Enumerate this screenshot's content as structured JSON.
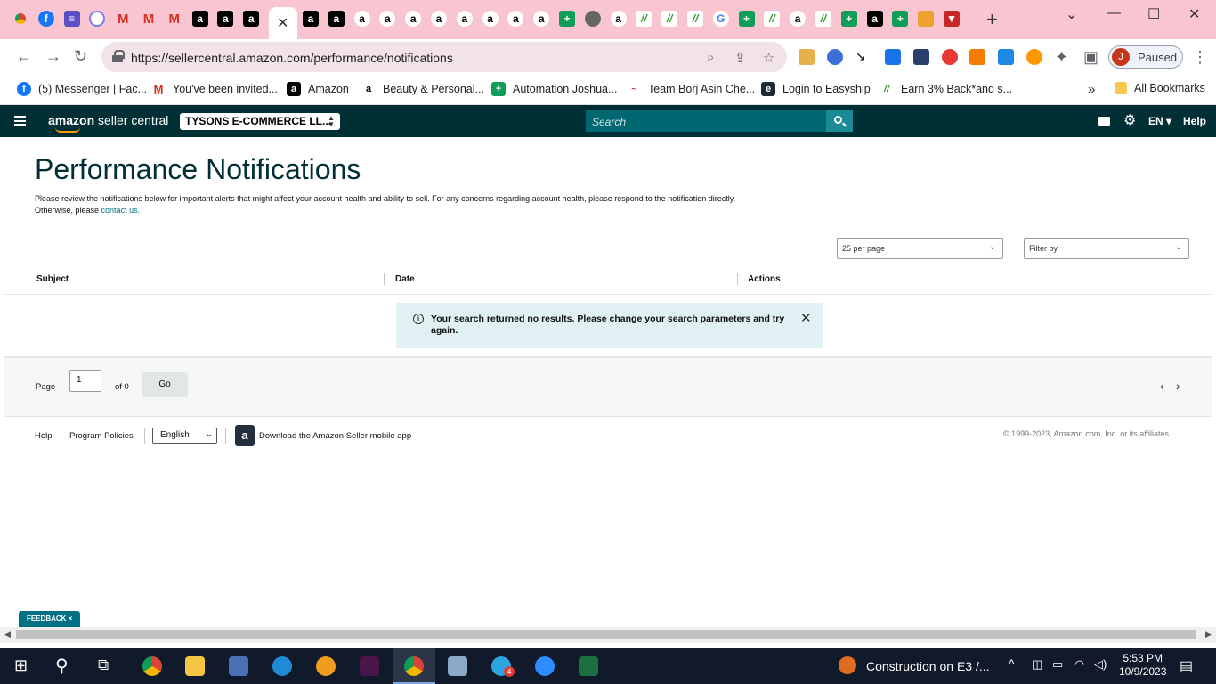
{
  "browser": {
    "tabs": {
      "icons": [
        "chrome-icon",
        "facebook-icon",
        "list-icon",
        "messenger-icon",
        "gmail-icon",
        "gmail-icon",
        "gmail-icon",
        "amazon-icon",
        "amazon-icon",
        "amazon-icon"
      ],
      "icons_after": [
        "amazon-icon",
        "amazon-icon",
        "amazon-icon",
        "amazon-icon",
        "amazon-icon",
        "amazon-icon",
        "amazon-icon",
        "amazon-icon",
        "amazon-icon",
        "amazon-icon",
        "sheets-icon",
        "globe-icon",
        "amazon-icon",
        "green-app-icon",
        "green-app-icon",
        "green-app-icon",
        "google-icon",
        "sheets-icon",
        "green-app-icon",
        "amazon-icon",
        "green-app-icon",
        "sheets-icon",
        "amazon-icon",
        "sheets-icon",
        "pencil-icon",
        "red-app-icon"
      ],
      "active_close_glyph": "✕",
      "new_tab_glyph": "+"
    },
    "window_controls": {
      "minimize": "—",
      "maximize": "☐",
      "close": "✕",
      "dropdown": "⌄"
    },
    "address_bar": {
      "url": "https://sellercentral.amazon.com/performance/notifications"
    },
    "profile": {
      "initial": "J",
      "status": "Paused"
    },
    "bookmarks": [
      {
        "label": "(5) Messenger | Fac...",
        "icon": "facebook-icon",
        "color": "#1877f2",
        "glyph": "f"
      },
      {
        "label": "You've been invited...",
        "icon": "gmail-icon",
        "color": "#d93025",
        "glyph": "M"
      },
      {
        "label": "Amazon",
        "icon": "amazon-icon",
        "color": "#000000",
        "glyph": "a"
      },
      {
        "label": "Beauty & Personal...",
        "icon": "amazon-icon",
        "color": "#ffffff",
        "glyph": "a"
      },
      {
        "label": "Automation Joshua...",
        "icon": "sheets-icon",
        "color": "#0f9d58",
        "glyph": "+"
      },
      {
        "label": "Team Borj Asin Che...",
        "icon": "team-icon",
        "color": "#ffffff",
        "glyph": "~"
      },
      {
        "label": "Login to Easyship",
        "icon": "easyship-icon",
        "color": "#1f2a36",
        "glyph": "e"
      },
      {
        "label": "Earn 3% Back*and s...",
        "icon": "green-app-icon",
        "color": "#ffffff",
        "glyph": "//"
      }
    ],
    "bookmarks_overflow": "»",
    "all_bookmarks": "All Bookmarks"
  },
  "seller_central": {
    "logo_amazon": "amazon",
    "logo_rest": " seller central",
    "account": "TYSONS E-COMMERCE LL...",
    "search_placeholder": "Search",
    "language": "EN ▾",
    "help": "Help"
  },
  "page": {
    "title": "Performance Notifications",
    "intro_line1": "Please review the notifications below for important alerts that might affect your account health and ability to sell. For any concerns regarding account health, please respond to the notification directly.",
    "intro_line2_prefix": "Otherwise, please ",
    "intro_link": "contact us.",
    "per_page": "25 per page",
    "filter_by": "Filter by",
    "columns": [
      "Subject",
      "Date",
      "Actions"
    ],
    "alert_message": "Your search returned no results. Please change your search parameters and try again.",
    "pager": {
      "page_label": "Page",
      "page_value": "1",
      "of_label": "of 0",
      "go_label": "Go"
    }
  },
  "footer": {
    "help": "Help",
    "program_policies": "Program Policies",
    "language": "English",
    "download_app": "Download the Amazon Seller mobile app",
    "copyright": "© 1999-2023, Amazon.com, Inc. or its affiliates",
    "feedback": "FEEDBACK ×"
  },
  "taskbar": {
    "notification_text": "Construction on E3 /...",
    "time": "5:53 PM",
    "date": "10/9/2023",
    "telegram_badge": "4"
  }
}
